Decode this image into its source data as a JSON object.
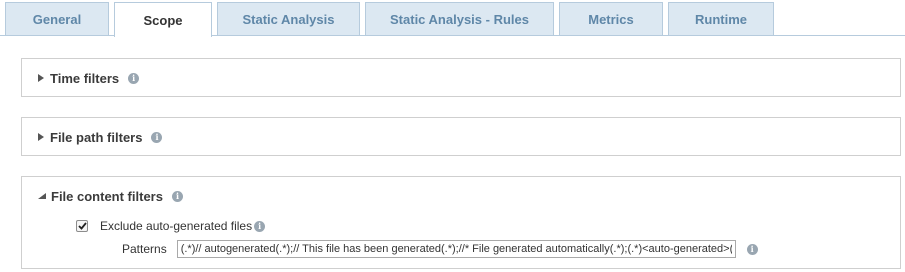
{
  "tabs": [
    {
      "label": "General",
      "active": false
    },
    {
      "label": "Scope",
      "active": true
    },
    {
      "label": "Static Analysis",
      "active": false
    },
    {
      "label": "Static Analysis - Rules",
      "active": false
    },
    {
      "label": "Metrics",
      "active": false
    },
    {
      "label": "Runtime",
      "active": false
    }
  ],
  "panels": {
    "time_filters": {
      "title": "Time filters",
      "expanded": false
    },
    "file_path_filters": {
      "title": "File path filters",
      "expanded": false
    },
    "file_content_filters": {
      "title": "File content filters",
      "expanded": true,
      "exclude_checkbox": {
        "label": "Exclude auto-generated files",
        "checked": true
      },
      "patterns": {
        "label": "Patterns",
        "value": "(.*)// autogenerated(.*);// This file has been generated(.*);//* File generated automatically(.*);(.*)<auto-generated>(.*)"
      }
    }
  },
  "info_icon_glyph": "i",
  "colors": {
    "tab_bg": "#dce8f2",
    "tab_text": "#5f87a8",
    "tab_border": "#b6cbdd",
    "panel_border": "#cfcfcf",
    "info_icon": "#99a6b1"
  }
}
